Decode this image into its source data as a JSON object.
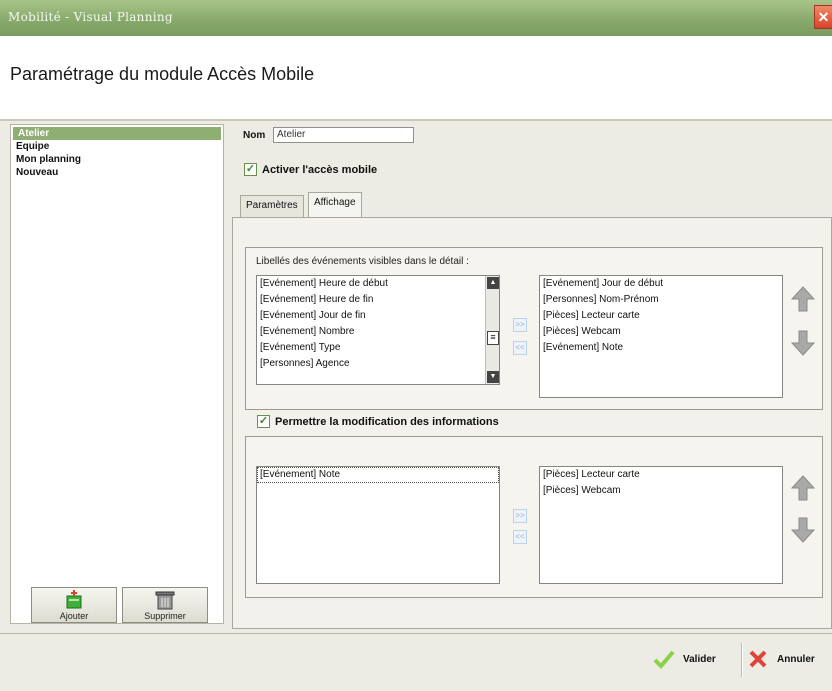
{
  "window": {
    "title": "Mobilité - Visual Planning",
    "close_glyph": "✕"
  },
  "page": {
    "title": "Paramétrage du module Accès Mobile"
  },
  "sidebar": {
    "items": [
      {
        "label": "Atelier",
        "selected": true
      },
      {
        "label": "Equipe",
        "selected": false
      },
      {
        "label": "Mon planning",
        "selected": false
      },
      {
        "label": "Nouveau",
        "selected": false
      }
    ],
    "add_label": "Ajouter",
    "delete_label": "Supprimer"
  },
  "form": {
    "nom_label": "Nom",
    "nom_value": "Atelier",
    "enable_mobile": {
      "label": "Activer l'accès mobile",
      "checked": true
    }
  },
  "tabs": [
    {
      "label": "Paramètres",
      "active": false
    },
    {
      "label": "Affichage",
      "active": true
    }
  ],
  "visible_events": {
    "title": "Libellés des événements visibles dans le détail :",
    "available": [
      "[Evénement] Heure de début",
      "[Evénement] Heure de fin",
      "[Evénement] Jour de fin",
      "[Evénement] Nombre",
      "[Evénement] Type",
      "[Personnes] Agence"
    ],
    "selected": [
      "[Evénement] Jour de début",
      "[Personnes] Nom-Prénom",
      "[Pièces] Lecteur carte",
      "[Pièces] Webcam",
      "[Evénement] Note"
    ],
    "add_glyph": ">>",
    "remove_glyph": "<<"
  },
  "modification": {
    "label": "Permettre la modification des informations",
    "checked": true,
    "available": [
      "[Evénement] Note"
    ],
    "selected": [
      "[Pièces] Lecteur carte",
      "[Pièces] Webcam"
    ],
    "add_glyph": ">>",
    "remove_glyph": "<<"
  },
  "actions": {
    "validate_label": "Valider",
    "cancel_label": "Annuler"
  },
  "colors": {
    "titlebar": "#86a86a",
    "selection": "#8fae72",
    "close": "#d9432a",
    "arrow_gray": "#a9a9a9"
  }
}
